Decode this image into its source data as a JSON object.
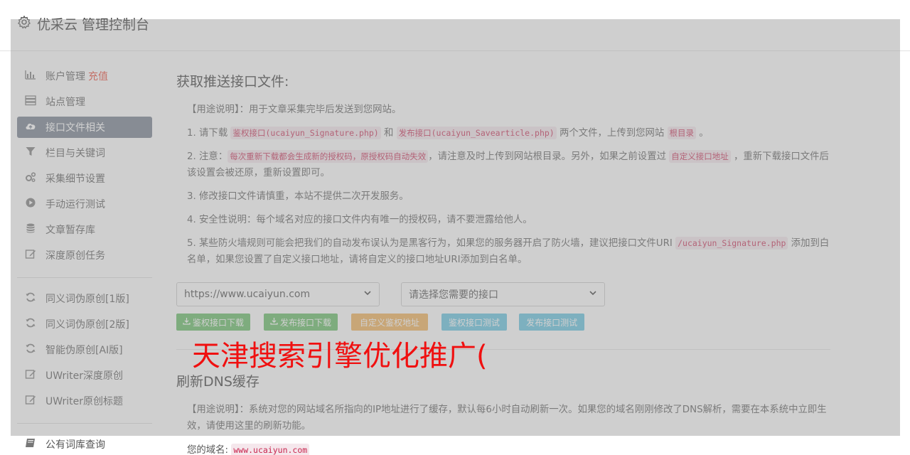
{
  "header": {
    "title": "优采云 管理控制台",
    "icon": "gear-icon"
  },
  "sidebar": {
    "group1": [
      {
        "label": "账户管理",
        "extra": "充值",
        "icon": "bar-chart-icon"
      },
      {
        "label": "站点管理",
        "icon": "server-icon"
      },
      {
        "label": "接口文件相关",
        "icon": "cloud-upload-icon",
        "active": true
      },
      {
        "label": "栏目与关键词",
        "icon": "filter-icon"
      },
      {
        "label": "采集细节设置",
        "icon": "gears-icon"
      },
      {
        "label": "手动运行测试",
        "icon": "play-circle-icon"
      },
      {
        "label": "文章暂存库",
        "icon": "database-icon"
      },
      {
        "label": "深度原创任务",
        "icon": "edit-icon"
      }
    ],
    "group2": [
      {
        "label": "同义词伪原创[1版]",
        "icon": "refresh-icon"
      },
      {
        "label": "同义词伪原创[2版]",
        "icon": "refresh-icon"
      },
      {
        "label": "智能伪原创[AI版]",
        "icon": "refresh-icon"
      },
      {
        "label": "UWriter深度原创",
        "icon": "edit-icon"
      },
      {
        "label": "UWriter原创标题",
        "icon": "edit-icon"
      }
    ],
    "group3": [
      {
        "label": "公有词库查询",
        "icon": "book-icon"
      }
    ]
  },
  "section1": {
    "title": "获取推送接口文件:",
    "p0": "【用途说明】：用于文章采集完毕后发送到您网站。",
    "p1_a": "1. 请下载 ",
    "p1_code1": "鉴权接口(ucaiyun_Signature.php)",
    "p1_b": " 和 ",
    "p1_code2": "发布接口(ucaiyun_Savearticle.php)",
    "p1_c": " 两个文件，上传到您网站 ",
    "p1_code3": "根目录",
    "p1_d": " 。",
    "p2_a": "2. 注意：",
    "p2_code1": "每次重新下载都会生成新的授权码，原授权码自动失效",
    "p2_b": "，请注意及时上传到网站根目录。另外，如果之前设置过 ",
    "p2_code2": "自定义接口地址",
    "p2_c": " ，重新下载接口文件后该设置会被还原，重新设置即可。",
    "p3": "3. 修改接口文件请慎重，本站不提供二次开发服务。",
    "p4": "4. 安全性说明：每个域名对应的接口文件内有唯一的授权码，请不要泄露给他人。",
    "p5_a": "5. 某些防火墙规则可能会把我们的自动发布误认为是黑客行为，如果您的服务器开启了防火墙，建议把接口文件URI ",
    "p5_code": "/ucaiyun_Signature.php",
    "p5_b": " 添加到白名单，如果您设置了自定义接口地址，请将自定义的接口地址URI添加到白名单。",
    "select_site": "https://www.ucaiyun.com",
    "select_api": "请选择您需要的接口",
    "buttons": {
      "auth_download": "鉴权接口下载",
      "publish_download": "发布接口下载",
      "custom_auth": "自定义鉴权地址",
      "auth_test": "鉴权接口测试",
      "publish_test": "发布接口测试"
    }
  },
  "section2": {
    "title": "刷新DNS缓存",
    "p0": "【用途说明】：系统对您的网站域名所指向的IP地址进行了缓存，默认每6小时自动刷新一次。如果您的域名刚刚修改了DNS解析，需要在本系统中立即生效，请使用这里的刷新功能。",
    "domain_label": "您的域名: ",
    "domain_value": "www.ucaiyun.com"
  },
  "watermark": "天津搜索引擎优化推广("
}
